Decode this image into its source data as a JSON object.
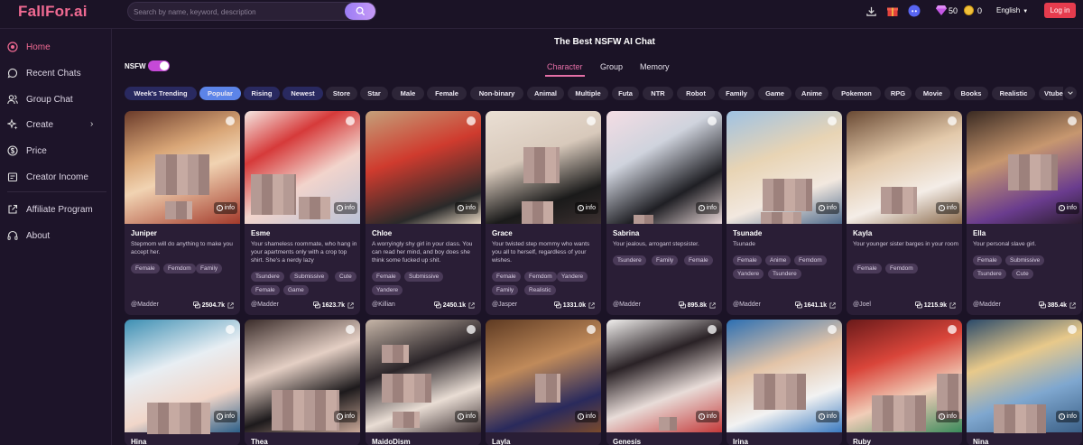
{
  "header": {
    "logo": "FallFor.ai",
    "search_placeholder": "Search by name, keyword, description",
    "gems": "50",
    "coins": "0",
    "language": "English",
    "login": "Log in"
  },
  "sidebar": {
    "items": [
      {
        "label": "Home",
        "icon": "home-icon"
      },
      {
        "label": "Recent Chats",
        "icon": "chat-bubble-icon"
      },
      {
        "label": "Group Chat",
        "icon": "users-icon"
      },
      {
        "label": "Create",
        "icon": "sparkle-icon"
      },
      {
        "label": "Price",
        "icon": "dollar-icon"
      },
      {
        "label": "Creator Income",
        "icon": "wallet-icon"
      },
      {
        "label": "Affiliate Program",
        "icon": "share-icon"
      },
      {
        "label": "About",
        "icon": "headset-icon"
      }
    ]
  },
  "main": {
    "title": "The Best NSFW AI Chat",
    "nsfw_label": "NSFW",
    "tabs": [
      "Character",
      "Group",
      "Memory"
    ],
    "chips": [
      "Week's Trending",
      "Popular",
      "Rising",
      "Newest",
      "Store",
      "Star",
      "Male",
      "Female",
      "Non-binary",
      "Animal",
      "Multiple",
      "Futa",
      "NTR",
      "Robot",
      "Family",
      "Game",
      "Anime",
      "Pokemon",
      "RPG",
      "Movie",
      "Books",
      "Realistic",
      "Vtuber"
    ],
    "info_label": "info"
  },
  "cards_row1": [
    {
      "name": "Juniper",
      "desc": "Stepmom will do anything to make you accept her.",
      "tags": [
        "Female",
        "Femdom",
        "Family"
      ],
      "author": "@Madder",
      "count": "2504.7k"
    },
    {
      "name": "Esme",
      "desc": "Your shameless roommate, who hang in your apartments only with a crop top shirt. She's a nerdy lazy",
      "tags": [
        "Tsundere",
        "Submissive",
        "Cute",
        "Female",
        "Game"
      ],
      "author": "@Madder",
      "count": "1623.7k"
    },
    {
      "name": "Chloe",
      "desc": "A worryingly shy girl in your class. You can read her mind, and boy does she think some fucked up shit.",
      "tags": [
        "Female",
        "Submissive",
        "Yandere"
      ],
      "author": "@Killian",
      "count": "2450.1k"
    },
    {
      "name": "Grace",
      "desc": "Your twisted step mommy who wants you all to herself, regardless of your wishes.",
      "tags": [
        "Female",
        "Femdom",
        "Yandere",
        "Family",
        "Realistic"
      ],
      "author": "@Jasper",
      "count": "1331.0k"
    },
    {
      "name": "Sabrina",
      "desc": "Your jealous, arrogant stepsister.",
      "tags": [
        "Tsundere",
        "Family",
        "Female"
      ],
      "author": "@Madder",
      "count": "895.8k"
    },
    {
      "name": "Tsunade",
      "desc": "Tsunade",
      "tags": [
        "Female",
        "Anime",
        "Femdom",
        "Yandere",
        "Tsundere"
      ],
      "author": "@Madder",
      "count": "1641.1k"
    },
    {
      "name": "Kayla",
      "desc": "Your younger sister barges in your room",
      "tags": [
        "Female",
        "Femdom"
      ],
      "author": "@Joel",
      "count": "1215.9k"
    },
    {
      "name": "Ella",
      "desc": "Your personal slave girl.",
      "tags": [
        "Female",
        "Submissive",
        "Tsundere",
        "Cute"
      ],
      "author": "@Madder",
      "count": "385.4k"
    }
  ],
  "cards_row2": [
    {
      "name": "Hina"
    },
    {
      "name": "Thea"
    },
    {
      "name": "MaidoDism"
    },
    {
      "name": "Layla"
    },
    {
      "name": "Genesis"
    },
    {
      "name": "Irina"
    },
    {
      "name": "Ruby"
    },
    {
      "name": "Nina"
    }
  ]
}
